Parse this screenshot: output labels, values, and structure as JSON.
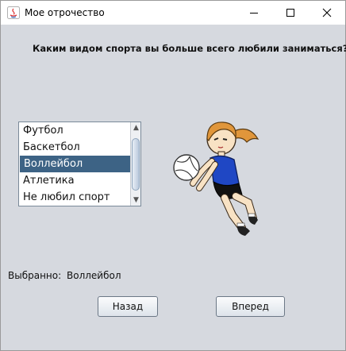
{
  "window": {
    "title": "Мое отрочество",
    "controls": {
      "minimize_icon": "minimize-icon",
      "maximize_icon": "maximize-icon",
      "close_icon": "close-icon"
    }
  },
  "question": "Каким видом спорта вы больше всего любили заниматься?",
  "sports_list": {
    "items": [
      "Футбол",
      "Баскетбол",
      "Воллейбол",
      "Атлетика",
      "Не любил спорт"
    ],
    "selected_index": 2
  },
  "illustration": {
    "icon": "volleyball-player-illustration"
  },
  "selection": {
    "label": "Выбранно:",
    "value": "Воллейбол"
  },
  "buttons": {
    "back_label": "Назад",
    "next_label": "Вперед"
  },
  "colors": {
    "background": "#d6d9df",
    "selection": "#3d6385",
    "shirt": "#1f47c4",
    "hair": "#e0963b"
  }
}
